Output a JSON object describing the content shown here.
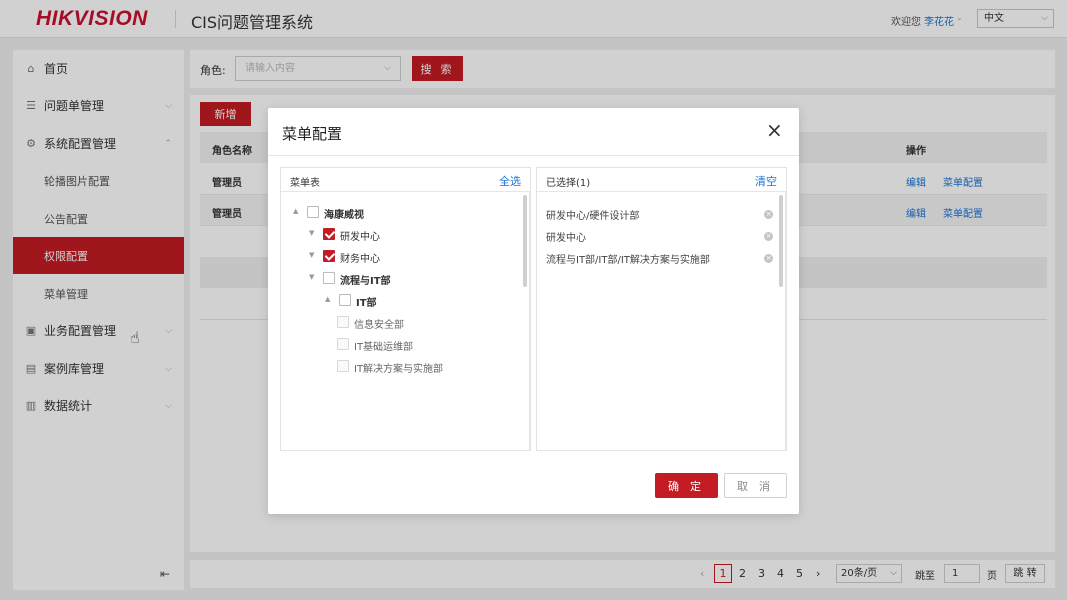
{
  "header": {
    "logo": "HIKVISION",
    "title": "CIS问题管理系统",
    "welcome": "欢迎您",
    "username": "李花花",
    "language": "中文"
  },
  "sidebar": {
    "items": [
      {
        "label": "首页",
        "icon": "home-icon"
      },
      {
        "label": "问题单管理",
        "icon": "list-icon"
      },
      {
        "label": "系统配置管理",
        "icon": "config-icon"
      },
      {
        "label": "轮播图片配置"
      },
      {
        "label": "公告配置"
      },
      {
        "label": "权限配置"
      },
      {
        "label": "菜单管理"
      },
      {
        "label": "业务配置管理",
        "icon": "briefcase-icon"
      },
      {
        "label": "案例库管理",
        "icon": "archive-icon"
      },
      {
        "label": "数据统计",
        "icon": "chart-icon"
      }
    ],
    "active_index": 5
  },
  "search": {
    "role_label": "角色:",
    "role_placeholder": "请输入内容",
    "search_button": "搜 索"
  },
  "content": {
    "add_button": "新增",
    "columns": [
      "角色名称",
      "操作"
    ],
    "rows": [
      {
        "name": "管理员",
        "edit": "编辑",
        "menu_config": "菜单配置"
      },
      {
        "name": "管理员",
        "edit": "编辑",
        "menu_config": "菜单配置"
      }
    ]
  },
  "pagination": {
    "prev": "‹",
    "pages": [
      "1",
      "2",
      "3",
      "4",
      "5"
    ],
    "current": "1",
    "next": "›",
    "page_size": "20条/页",
    "goto_label": "跳至",
    "goto_value": "1",
    "page_unit": "页",
    "goto_button": "跳 转"
  },
  "modal": {
    "title": "菜单配置",
    "close": "×",
    "left_pane": {
      "title": "菜单表",
      "action": "全选",
      "tree": [
        {
          "label": "海康威视",
          "level": 0,
          "toggle": "▲",
          "checked": false,
          "bold": true
        },
        {
          "label": "研发中心",
          "level": 1,
          "toggle": "▼",
          "checked": true,
          "bold": false
        },
        {
          "label": "财务中心",
          "level": 1,
          "toggle": "▼",
          "checked": true,
          "bold": false
        },
        {
          "label": "流程与IT部",
          "level": 1,
          "toggle": "▼",
          "checked": false,
          "bold": true
        },
        {
          "label": "IT部",
          "level": 2,
          "toggle": "▲",
          "checked": false,
          "bold": true
        },
        {
          "label": "信息安全部",
          "level": 3,
          "toggle": "",
          "checked": false,
          "bold": false
        },
        {
          "label": "IT基础运维部",
          "level": 3,
          "toggle": "",
          "checked": false,
          "bold": false
        },
        {
          "label": "IT解决方案与实施部",
          "level": 3,
          "toggle": "",
          "checked": false,
          "bold": false
        }
      ]
    },
    "right_pane": {
      "title": "已选择(1)",
      "action": "清空",
      "selected": [
        "研发中心/硬件设计部",
        "研发中心",
        "流程与IT部/IT部/IT解决方案与实施部"
      ]
    },
    "ok_button": "确 定",
    "cancel_button": "取 消"
  }
}
